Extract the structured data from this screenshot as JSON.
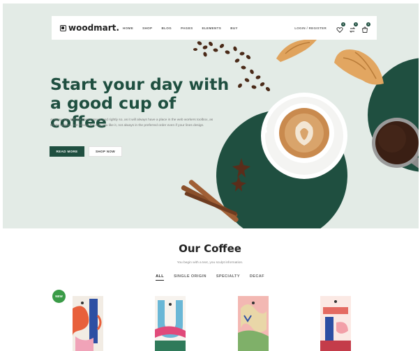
{
  "nav": {
    "logo": "woodmart.",
    "menu": [
      "HOME",
      "SHOP",
      "BLOG",
      "PAGES",
      "ELEMENTS",
      "BUY"
    ],
    "login": "LOGIN / REGISTER",
    "wishlist_count": "0",
    "compare_count": "0",
    "cart_count": "0"
  },
  "hero": {
    "title": "Start your day with a good cup of coffee",
    "subtitle": "Anyway, you still use Lorem Ipsum and rightly so, as it will always have a place in the web workers toolbox, as things happen, not always the way you like it, not always in the preferred order even if your lines design.",
    "primary_button": "READ MORE",
    "secondary_button": "SHOP NOW"
  },
  "coffee": {
    "title": "Our Coffee",
    "subtitle": "You begin with a text, you sculpt information.",
    "filters": [
      "ALL",
      "SINGLE ORIGIN",
      "SPECIALTY",
      "DECAF"
    ],
    "new_badge": "NEW"
  },
  "colors": {
    "brand_green": "#1f4f40",
    "hero_bg": "#e3ebe6",
    "badge_green": "#3a9b47"
  },
  "icons": [
    "search-icon",
    "heart-icon",
    "compare-icon",
    "cart-icon"
  ]
}
